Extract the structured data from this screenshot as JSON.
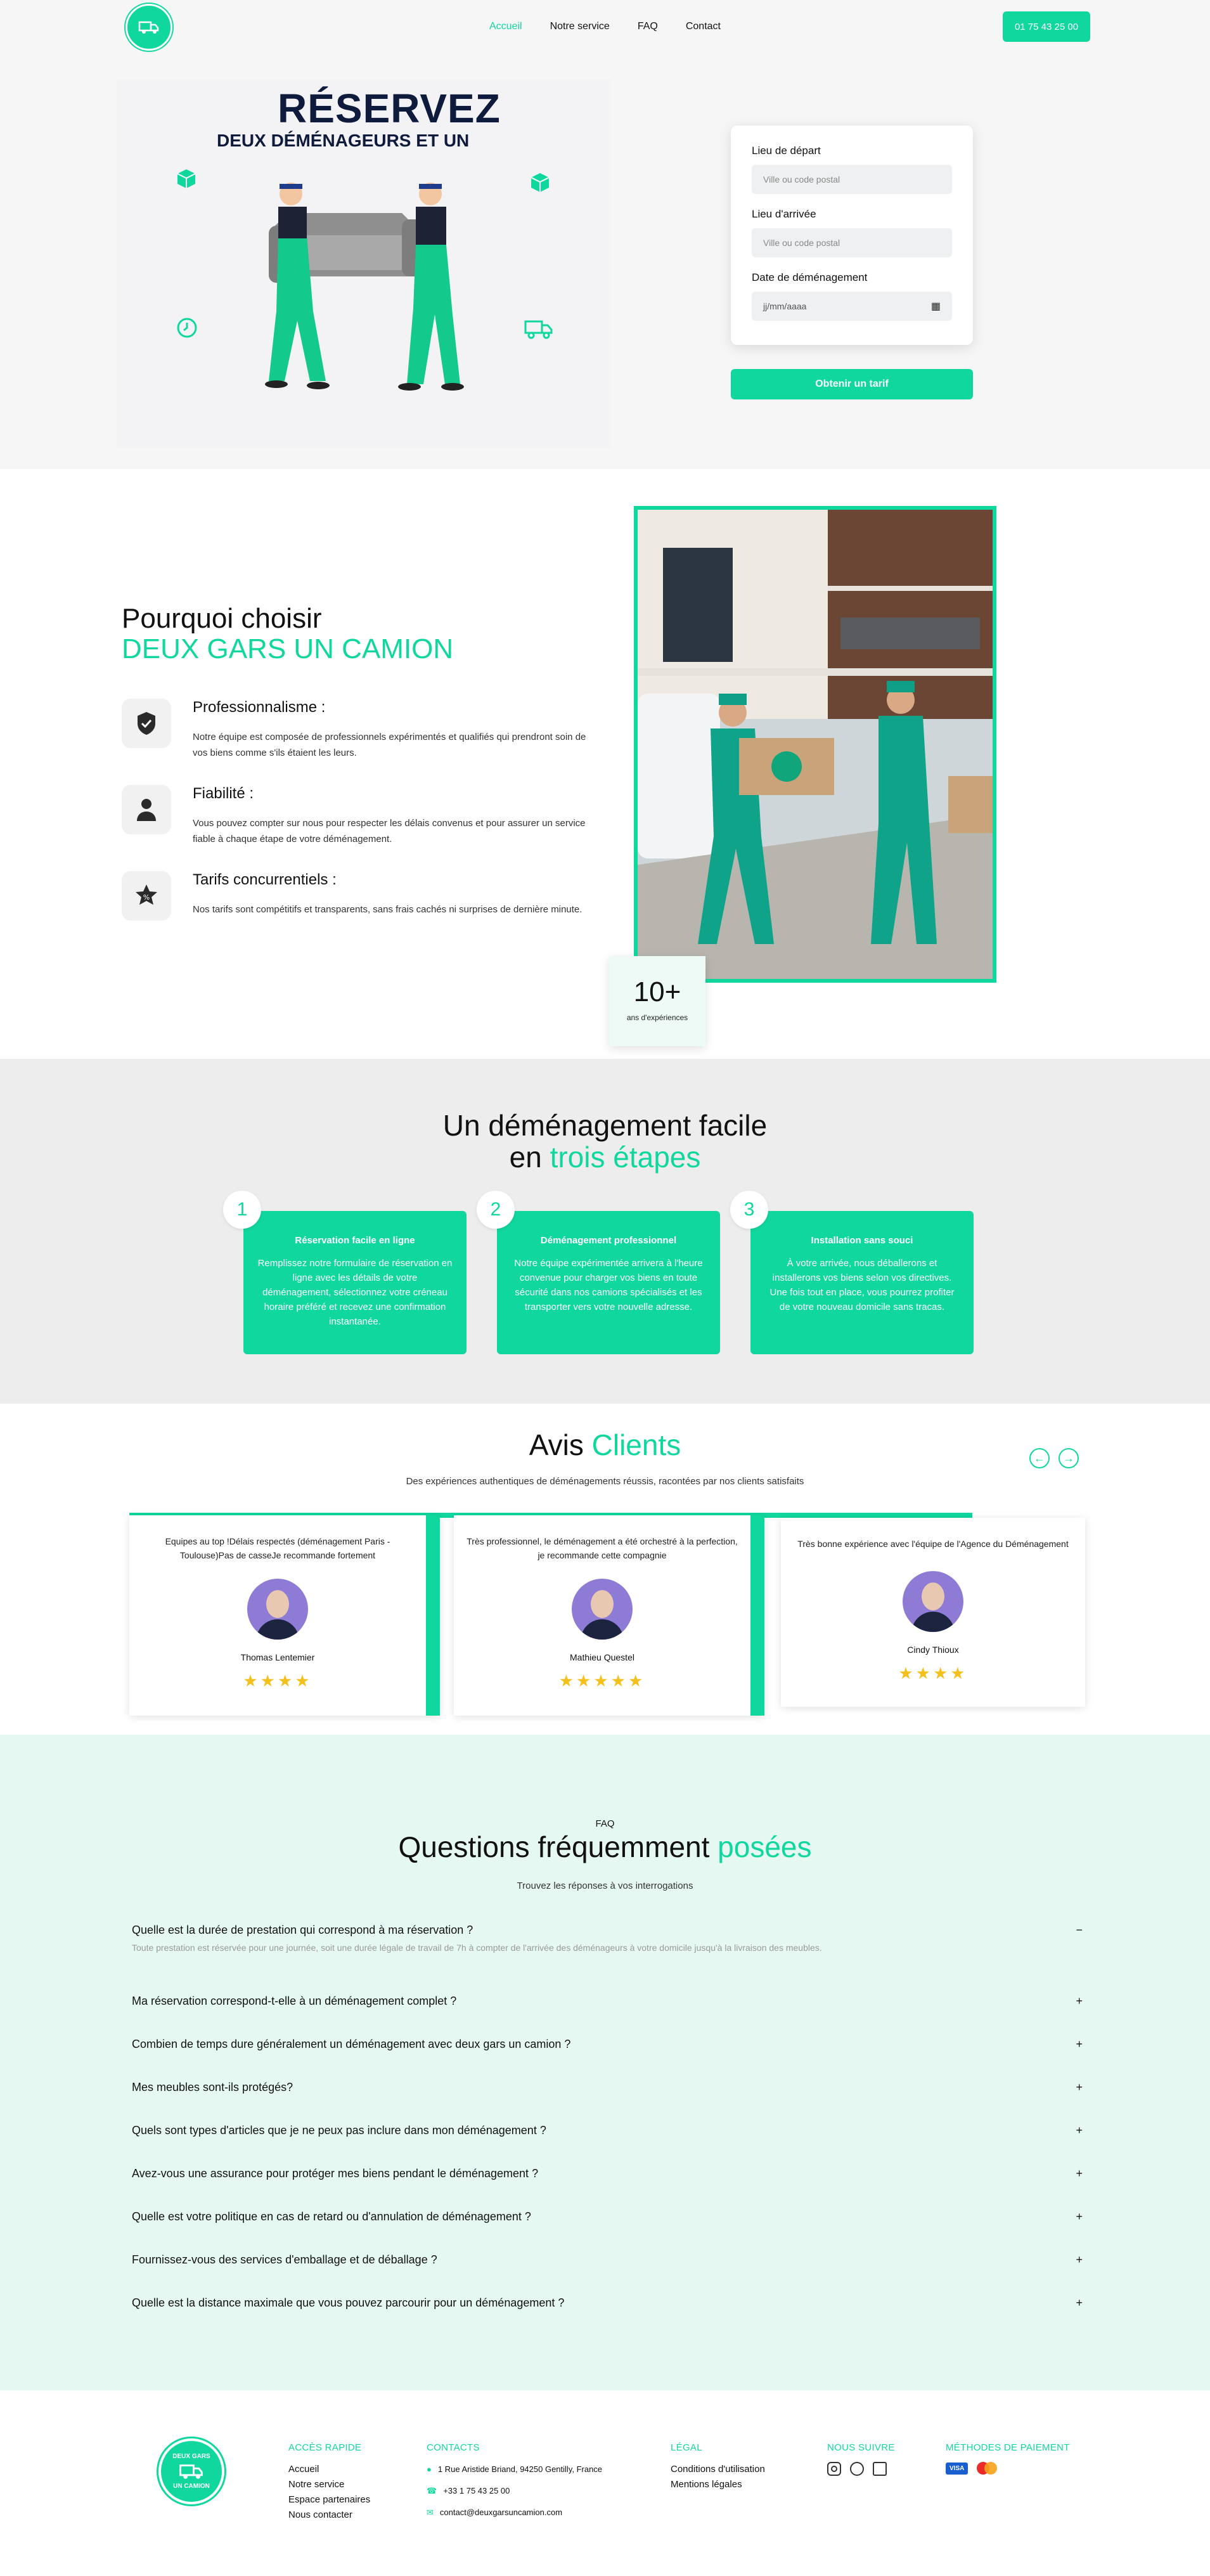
{
  "brand": {
    "logo_text_top": "DEUX GARS",
    "logo_text_bottom": "UN CAMION",
    "accent": "#10d79e",
    "dark": "#0f1b3d"
  },
  "nav": {
    "items": [
      "Accueil",
      "Notre service",
      "FAQ",
      "Contact"
    ],
    "phone": "01 75 43 25 00"
  },
  "hero": {
    "title": "RÉSERVEZ",
    "subtitle": "DEUX DÉMÉNAGEURS ET UN"
  },
  "quote_form": {
    "departure_label": "Lieu de départ",
    "departure_placeholder": "Ville ou code postal",
    "arrival_label": "Lieu d'arrivée",
    "arrival_placeholder": "Ville ou code postal",
    "date_label": "Date de déménagement",
    "date_placeholder": "jj/mm/aaaa",
    "submit_label": "Obtenir un tarif"
  },
  "why": {
    "title_line1": "Pourquoi choisir",
    "title_line2": "DEUX GARS UN CAMION",
    "features": [
      {
        "icon": "badge-check-icon",
        "title": "Professionnalisme :",
        "text": "Notre équipe est composée de professionnels expérimentés et qualifiés qui prendront soin de vos biens comme s'ils étaient les leurs."
      },
      {
        "icon": "person-icon",
        "title": "Fiabilité :",
        "text": "Vous pouvez compter sur nous pour respecter les délais convenus et pour assurer un service fiable à chaque étape de votre déménagement."
      },
      {
        "icon": "price-tag-star-icon",
        "title": "Tarifs concurrentiels :",
        "text": "Nos tarifs sont compétitifs et transparents, sans frais cachés ni surprises de dernière minute."
      }
    ],
    "experience_number": "10+",
    "experience_label": "ans d'expériences"
  },
  "steps": {
    "title_line1": "Un déménagement facile",
    "title_line2_a": "en ",
    "title_line2_b": "trois étapes",
    "items": [
      {
        "num": "1",
        "title": "Réservation facile en ligne",
        "text": "Remplissez notre formulaire de réservation en ligne avec les détails de votre déménagement, sélectionnez votre créneau horaire préféré et recevez une confirmation instantanée."
      },
      {
        "num": "2",
        "title": "Déménagement professionnel",
        "text": "Notre équipe expérimentée arrivera à l'heure convenue pour charger vos biens en toute sécurité dans nos camions spécialisés et les transporter vers votre nouvelle adresse."
      },
      {
        "num": "3",
        "title": "Installation sans souci",
        "text": "À votre arrivée, nous déballerons et installerons vos biens selon vos directives. Une fois tout en place, vous pourrez profiter de votre nouveau domicile sans tracas."
      }
    ]
  },
  "reviews": {
    "title_a": "Avis ",
    "title_b": "Clients",
    "subtitle": "Des expériences authentiques de déménagements réussis, racontées par nos clients satisfaits",
    "items": [
      {
        "text": "Equipes au top !Délais respectés (déménagement Paris -Toulouse)Pas de casseJe recommande fortement",
        "name": "Thomas Lentemier",
        "stars": "★★★★"
      },
      {
        "text": "Très professionnel, le déménagement a été orchestré à la perfection, je recommande cette compagnie",
        "name": "Mathieu Questel",
        "stars": "★★★★★"
      },
      {
        "text": "Très bonne expérience avec l'équipe de l'Agence du Déménagement",
        "name": "Cindy Thioux",
        "stars": "★★★★"
      }
    ]
  },
  "faq": {
    "kicker": "FAQ",
    "title_a": "Questions fréquemment ",
    "title_b": "posées",
    "subtitle": "Trouvez les réponses à vos interrogations",
    "open_answer": "Toute prestation est réservée pour une journée, soit une durée légale de travail de 7h à compter de l'arrivée des déménageurs à votre domicile jusqu'à la livraison des meubles.",
    "items": [
      {
        "q": "Quelle est la durée de prestation qui correspond à ma réservation ?",
        "toggle": "−"
      },
      {
        "q": "Ma réservation correspond-t-elle à un déménagement complet ?",
        "toggle": "+"
      },
      {
        "q": "Combien de temps dure généralement un déménagement avec deux gars un camion ?",
        "toggle": "+"
      },
      {
        "q": "Mes meubles sont-ils protégés?",
        "toggle": "+"
      },
      {
        "q": "Quels sont types d'articles que je ne peux pas inclure dans mon déménagement ?",
        "toggle": "+"
      },
      {
        "q": "Avez-vous une assurance pour protéger mes biens pendant le déménagement ?",
        "toggle": "+"
      },
      {
        "q": "Quelle est votre politique en cas de retard ou d'annulation de déménagement ?",
        "toggle": "+"
      },
      {
        "q": "Fournissez-vous des services d'emballage et de déballage ?",
        "toggle": "+"
      },
      {
        "q": "Quelle est la distance maximale que vous pouvez parcourir pour un déménagement ?",
        "toggle": "+"
      }
    ]
  },
  "footer": {
    "quick_title": "ACCÈS RAPIDE",
    "quick_links": [
      "Accueil",
      "Notre service",
      "Espace partenaires",
      "Nous contacter"
    ],
    "contacts_title": "CONTACTS",
    "address": "1 Rue Aristide Briand, 94250 Gentilly, France",
    "phone": "+33 1 75 43 25 00",
    "email": "contact@deuxgarsuncamion.com",
    "legal_title": "LÉGAL",
    "legal_links": [
      "Conditions d'utilisation",
      "Mentions légales"
    ],
    "follow_title": "NOUS SUIVRE",
    "payment_title": "MÉTHODES DE PAIEMENT",
    "visa": "VISA"
  }
}
